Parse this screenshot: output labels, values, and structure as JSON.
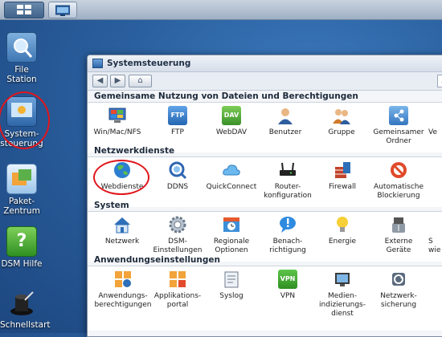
{
  "desktop": {
    "icons": [
      {
        "label": "File Station",
        "icon": "file-station-icon"
      },
      {
        "label": "System-\nsteuerung",
        "icon": "control-panel-icon"
      },
      {
        "label": "Paket-\nZentrum",
        "icon": "package-center-icon"
      },
      {
        "label": "DSM Hilfe",
        "icon": "help-icon"
      },
      {
        "label": "Schnellstart",
        "icon": "quick-start-icon"
      }
    ]
  },
  "window": {
    "title": "Systemsteuerung",
    "back": "◀",
    "forward": "▶",
    "home": "⌂",
    "search": "⌕"
  },
  "sections": [
    {
      "title": "Gemeinsame Nutzung von Dateien und Berechtigungen",
      "items": [
        {
          "label": "Win/Mac/NFS",
          "icon": "win-mac-nfs-icon"
        },
        {
          "label": "FTP",
          "icon": "ftp-icon"
        },
        {
          "label": "WebDAV",
          "icon": "webdav-icon"
        },
        {
          "label": "Benutzer",
          "icon": "user-icon"
        },
        {
          "label": "Gruppe",
          "icon": "group-icon"
        },
        {
          "label": "Gemeinsamer\nOrdner",
          "icon": "shared-folder-icon"
        },
        {
          "label": "Ve",
          "icon": "truncated-icon"
        }
      ]
    },
    {
      "title": "Netzwerkdienste",
      "items": [
        {
          "label": "Webdienste",
          "icon": "globe-icon"
        },
        {
          "label": "DDNS",
          "icon": "ddns-icon"
        },
        {
          "label": "QuickConnect",
          "icon": "cloud-icon"
        },
        {
          "label": "Router-\nkonfiguration",
          "icon": "router-icon"
        },
        {
          "label": "Firewall",
          "icon": "firewall-icon"
        },
        {
          "label": "Automatische\nBlockierung",
          "icon": "auto-block-icon"
        }
      ]
    },
    {
      "title": "System",
      "items": [
        {
          "label": "Netzwerk",
          "icon": "network-house-icon"
        },
        {
          "label": "DSM-\nEinstellungen",
          "icon": "gear-icon"
        },
        {
          "label": "Regionale\nOptionen",
          "icon": "clock-icon"
        },
        {
          "label": "Benach-\nrichtigung",
          "icon": "notification-icon"
        },
        {
          "label": "Energie",
          "icon": "lightbulb-icon"
        },
        {
          "label": "Externe\nGeräte",
          "icon": "usb-icon"
        },
        {
          "label": "S\nwie",
          "icon": "truncated-icon"
        }
      ]
    },
    {
      "title": "Anwendungseinstellungen",
      "items": [
        {
          "label": "Anwendungs-\nberechtigungen",
          "icon": "app-permissions-icon"
        },
        {
          "label": "Applikations-\nportal",
          "icon": "app-portal-icon"
        },
        {
          "label": "Syslog",
          "icon": "syslog-icon"
        },
        {
          "label": "VPN",
          "icon": "vpn-icon"
        },
        {
          "label": "Medien-\nindizierungs-\ndienst",
          "icon": "media-index-icon"
        },
        {
          "label": "Netzwerk-\nsicherung",
          "icon": "network-backup-icon"
        }
      ]
    }
  ],
  "icon_texts": {
    "ftp": "FTP",
    "dav": "DAV",
    "vpn": "VPN",
    "help": "?"
  }
}
